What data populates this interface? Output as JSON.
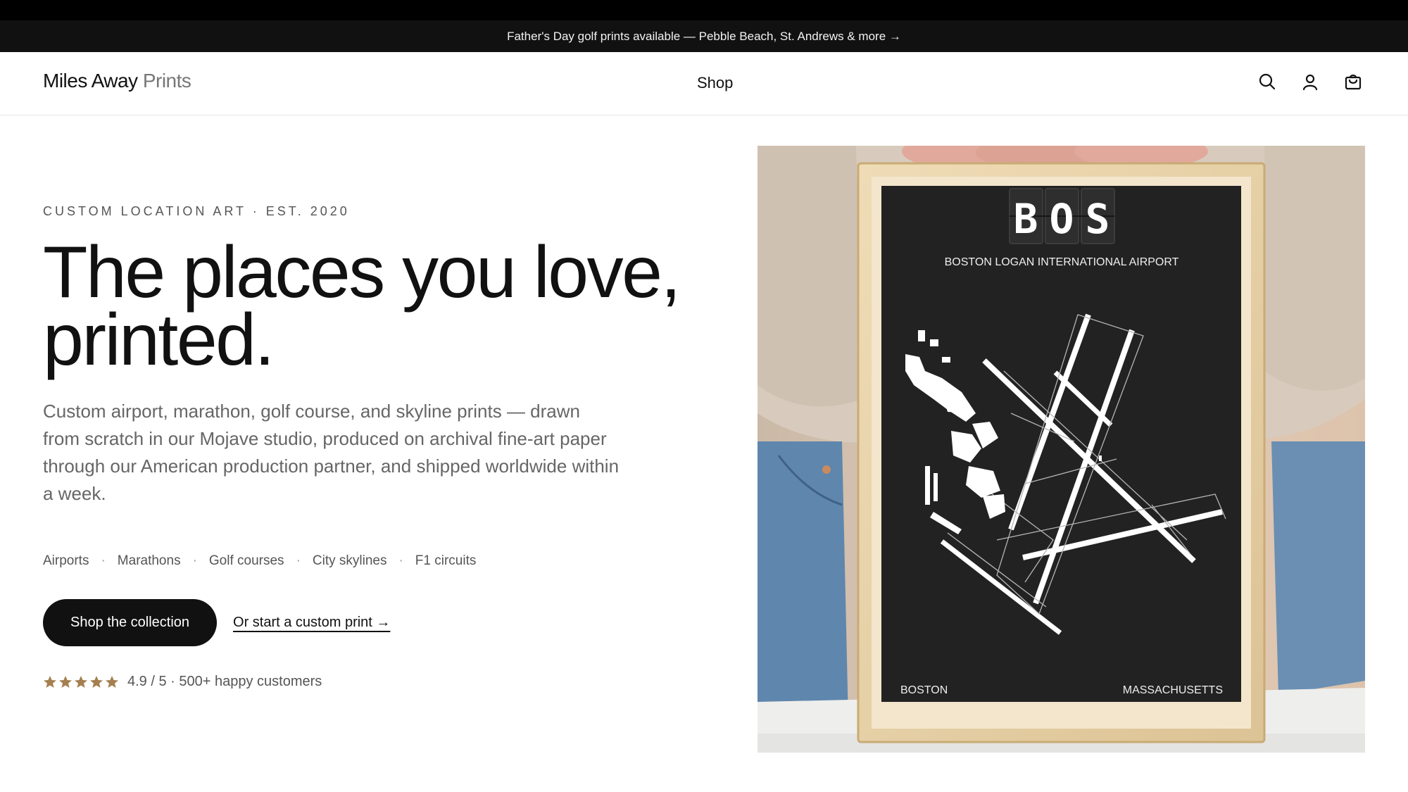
{
  "announcement": {
    "text": "Father's Day golf prints available — Pebble Beach, St. Andrews & more →"
  },
  "header": {
    "logo_bold": "Miles Away",
    "logo_light": "Prints",
    "nav": [
      {
        "label": "Shop"
      }
    ],
    "icons": [
      "search-icon",
      "account-icon",
      "cart-icon"
    ]
  },
  "hero": {
    "eyebrow": "CUSTOM LOCATION ART · EST. 2020",
    "headline_line1": "The places you love,",
    "headline_line2": "printed.",
    "description": "Custom airport, marathon, golf course, and skyline prints — drawn from scratch in our Mojave studio, produced on archival fine-art paper through our American production partner, and shipped worldwide within a week.",
    "categories": [
      "Airports",
      "Marathons",
      "Golf courses",
      "City skylines",
      "F1 circuits"
    ],
    "cta_primary": "Shop the collection",
    "cta_secondary": "Or start a custom print →",
    "rating": {
      "stars": 5,
      "text": "4.9 / 5 · 500+ happy customers"
    }
  },
  "poster": {
    "code_letters": [
      "B",
      "O",
      "S"
    ],
    "title": "BOSTON  LOGAN INTERNATIONAL AIRPORT",
    "bottom_left": "BOSTON",
    "bottom_right": "MASSACHUSETTS"
  },
  "colors": {
    "accent_dark": "#111111",
    "star": "#a57f4f",
    "poster_bg": "#222222",
    "frame": "#e5cfa0"
  }
}
